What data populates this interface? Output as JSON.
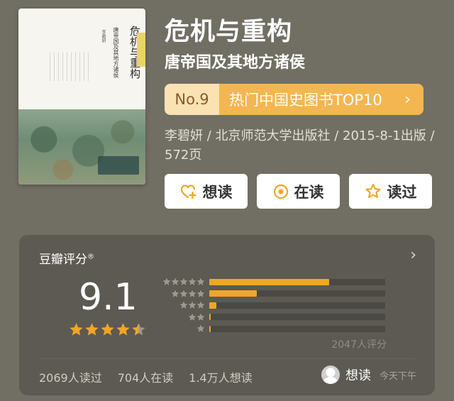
{
  "book": {
    "title": "危机与重构",
    "subtitle": "唐帝国及其地方诸侯",
    "cover": {
      "title": "危机与重构",
      "subtitle": "唐帝国及其地方诸侯",
      "author": "李碧妍"
    }
  },
  "ranking": {
    "number": "No.9",
    "label": "热门中国史图书TOP10",
    "chevron": "›"
  },
  "meta": {
    "text": "李碧妍 / 北京师范大学出版社 / 2015-8-1出版 / 572页",
    "chevron": "›"
  },
  "actions": [
    {
      "label": "想读",
      "icon": "heart-plus-icon"
    },
    {
      "label": "在读",
      "icon": "target-icon"
    },
    {
      "label": "读过",
      "icon": "star-outline-icon"
    }
  ],
  "rating": {
    "title": "豆瓣评分",
    "title_mark": "®",
    "chevron": "›",
    "score": "9.1",
    "stars": 4.5,
    "distribution": [
      {
        "stars": 5,
        "ratio": 0.68
      },
      {
        "stars": 4,
        "ratio": 0.27
      },
      {
        "stars": 3,
        "ratio": 0.04
      },
      {
        "stars": 2,
        "ratio": 0.005
      },
      {
        "stars": 1,
        "ratio": 0.005
      }
    ],
    "raters": "2047人评分"
  },
  "stats": {
    "read": "2069人读过",
    "reading": "704人在读",
    "wish": "1.4万人想读"
  },
  "mine": {
    "status": "想读",
    "time": "今天下午"
  },
  "colors": {
    "background": "#716e64",
    "accent": "#f4b650",
    "card": "#5c5a52",
    "bar": "#f1a529"
  }
}
